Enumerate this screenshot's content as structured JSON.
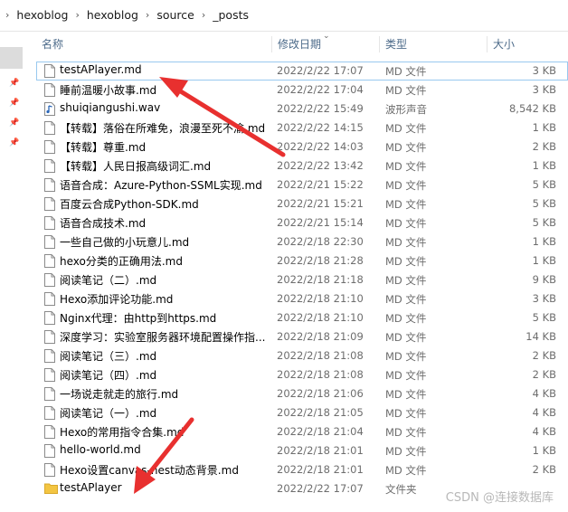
{
  "breadcrumb": [
    "hexoblog",
    "hexoblog",
    "source",
    "_posts"
  ],
  "columns": {
    "name": "名称",
    "date": "修改日期",
    "type": "类型",
    "size": "大小"
  },
  "files": [
    {
      "name": "testAPlayer.md",
      "date": "2022/2/22 17:07",
      "type": "MD 文件",
      "size": "3 KB",
      "icon": "document-icon",
      "selected": true
    },
    {
      "name": "睡前温暖小故事.md",
      "date": "2022/2/22 17:04",
      "type": "MD 文件",
      "size": "3 KB",
      "icon": "document-icon"
    },
    {
      "name": "shuiqiangushi.wav",
      "date": "2022/2/22 15:49",
      "type": "波形声音",
      "size": "8,542 KB",
      "icon": "audio-file-icon"
    },
    {
      "name": "【转载】落俗在所难免，浪漫至死不渝.md",
      "date": "2022/2/22 14:15",
      "type": "MD 文件",
      "size": "1 KB",
      "icon": "document-icon"
    },
    {
      "name": "【转载】尊重.md",
      "date": "2022/2/22 14:03",
      "type": "MD 文件",
      "size": "2 KB",
      "icon": "document-icon"
    },
    {
      "name": "【转载】人民日报高级词汇.md",
      "date": "2022/2/22 13:42",
      "type": "MD 文件",
      "size": "1 KB",
      "icon": "document-icon"
    },
    {
      "name": "语音合成：Azure-Python-SSML实现.md",
      "date": "2022/2/21 15:22",
      "type": "MD 文件",
      "size": "5 KB",
      "icon": "document-icon"
    },
    {
      "name": "百度云合成Python-SDK.md",
      "date": "2022/2/21 15:21",
      "type": "MD 文件",
      "size": "5 KB",
      "icon": "document-icon"
    },
    {
      "name": "语音合成技术.md",
      "date": "2022/2/21 15:14",
      "type": "MD 文件",
      "size": "5 KB",
      "icon": "document-icon"
    },
    {
      "name": "一些自己做的小玩意儿.md",
      "date": "2022/2/18 22:30",
      "type": "MD 文件",
      "size": "1 KB",
      "icon": "document-icon"
    },
    {
      "name": "hexo分类的正确用法.md",
      "date": "2022/2/18 21:28",
      "type": "MD 文件",
      "size": "1 KB",
      "icon": "document-icon"
    },
    {
      "name": "阅读笔记（二）.md",
      "date": "2022/2/18 21:18",
      "type": "MD 文件",
      "size": "9 KB",
      "icon": "document-icon"
    },
    {
      "name": "Hexo添加评论功能.md",
      "date": "2022/2/18 21:10",
      "type": "MD 文件",
      "size": "3 KB",
      "icon": "document-icon"
    },
    {
      "name": "Nginx代理：由http到https.md",
      "date": "2022/2/18 21:10",
      "type": "MD 文件",
      "size": "5 KB",
      "icon": "document-icon"
    },
    {
      "name": "深度学习：实验室服务器环境配置操作指...",
      "date": "2022/2/18 21:09",
      "type": "MD 文件",
      "size": "14 KB",
      "icon": "document-icon"
    },
    {
      "name": "阅读笔记（三）.md",
      "date": "2022/2/18 21:08",
      "type": "MD 文件",
      "size": "2 KB",
      "icon": "document-icon"
    },
    {
      "name": "阅读笔记（四）.md",
      "date": "2022/2/18 21:08",
      "type": "MD 文件",
      "size": "2 KB",
      "icon": "document-icon"
    },
    {
      "name": "一场说走就走的旅行.md",
      "date": "2022/2/18 21:06",
      "type": "MD 文件",
      "size": "4 KB",
      "icon": "document-icon"
    },
    {
      "name": "阅读笔记（一）.md",
      "date": "2022/2/18 21:05",
      "type": "MD 文件",
      "size": "4 KB",
      "icon": "document-icon"
    },
    {
      "name": "Hexo的常用指令合集.md",
      "date": "2022/2/18 21:04",
      "type": "MD 文件",
      "size": "4 KB",
      "icon": "document-icon"
    },
    {
      "name": "hello-world.md",
      "date": "2022/2/18 21:01",
      "type": "MD 文件",
      "size": "1 KB",
      "icon": "document-icon"
    },
    {
      "name": "Hexo设置canvas-nest动态背景.md",
      "date": "2022/2/18 21:01",
      "type": "MD 文件",
      "size": "2 KB",
      "icon": "document-icon"
    },
    {
      "name": "testAPlayer",
      "date": "2022/2/22 17:07",
      "type": "文件夹",
      "size": "",
      "icon": "folder-icon"
    }
  ],
  "watermark": "CSDN @连接数据库",
  "colors": {
    "accent": "#e8302f",
    "selection": "#99c9ef",
    "header_text": "#4d6b8a",
    "folder": "#f3c542"
  }
}
